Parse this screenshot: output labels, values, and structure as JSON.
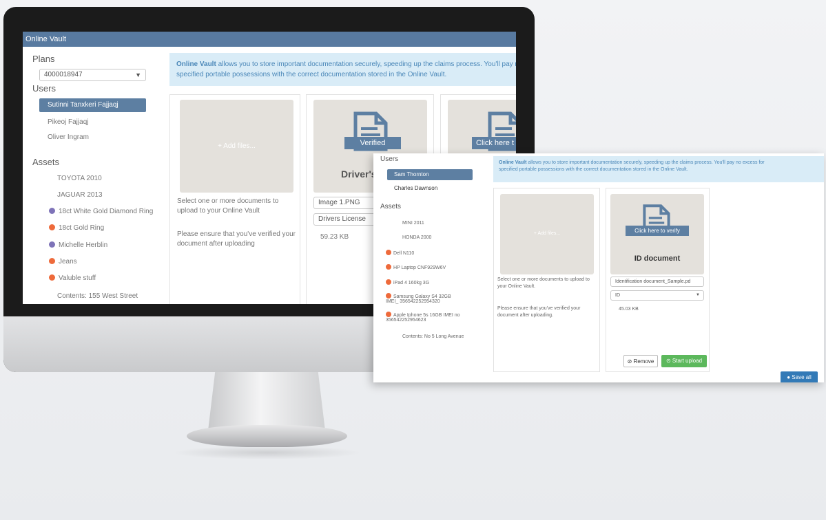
{
  "back_app": {
    "title": "Online Vault",
    "plans_label": "Plans",
    "plan_selected": "4000018947",
    "users_label": "Users",
    "users": [
      "Sutinni Tanxkeri Fajjaqj",
      "Pikeoj Fajjaqj",
      "Oliver Ingram"
    ],
    "assets_label": "Assets",
    "assets": [
      {
        "label": "TOYOTA 2010",
        "dot": ""
      },
      {
        "label": "JAGUAR 2013",
        "dot": ""
      },
      {
        "label": "18ct White Gold Diamond Ring",
        "dot": "purple"
      },
      {
        "label": "18ct Gold Ring",
        "dot": "orange"
      },
      {
        "label": "Michelle Herblin",
        "dot": "purple"
      },
      {
        "label": "Jeans",
        "dot": "orange"
      },
      {
        "label": "Valuble stuff",
        "dot": "orange"
      },
      {
        "label": "Contents: 155 West Street",
        "dot": ""
      }
    ],
    "info_line1_bold": "Online Vault",
    "info_line1": " allows you to store important documentation securely, speeding up the claims process. You'll pay no",
    "info_line2": "specified portable possessions with the correct documentation stored in the Online Vault.",
    "add_files": "Add files...",
    "upload_help": "Select one or more documents to upload to your Online Vault",
    "verify_help": "Please ensure that you've verified your document after uploading",
    "doc1_ribbon": "Verified",
    "doc1_title": "Driver's",
    "doc1_filename": "Image 1.PNG",
    "doc1_type": "Drivers License",
    "doc1_size": "59.23 KB",
    "doc2_ribbon": "Click here t"
  },
  "front_app": {
    "users_label": "Users",
    "users": [
      "Sam Thornton",
      "Charles Dawnson"
    ],
    "assets_label": "Assets",
    "assets": [
      {
        "label": "MINI 2011",
        "dot": ""
      },
      {
        "label": "HONDA 2000",
        "dot": ""
      },
      {
        "label": "Dell N110",
        "dot": "orange"
      },
      {
        "label": "HP Laptop CNF929W6V",
        "dot": "orange"
      },
      {
        "label": "iPad 4 160kg 3G",
        "dot": "orange"
      },
      {
        "label": "Samsung Galaxy S4 32GB",
        "label2": "IMEI_ 356542252954320",
        "dot": "orange"
      },
      {
        "label": "Apple Iphone 5s 16GB IMEI no",
        "label2": "356542252954623",
        "dot": "orange"
      },
      {
        "label": "Contents: No 5 Long Avenue",
        "dot": ""
      }
    ],
    "info_line1_bold": "Online Vault",
    "info_line1": " allows you to store important documentation securely, speeding up the claims process. You'll pay no excess for",
    "info_line2": "specified portable possessions with the correct documentation stored in the Online Vault.",
    "add_files": "Add files...",
    "upload_help": "Select one or more documents to upload to your Online Vault.",
    "verify_help": "Please ensure that you've verified your document after uploading.",
    "doc_ribbon": "Click here to verify",
    "doc_title": "ID document",
    "doc_filename": "Identification document_Sample.pd",
    "doc_type": "ID",
    "doc_size": "45.03 KB",
    "remove_label": "Remove",
    "start_upload_label": "Start upload",
    "save_all_label": "Save all"
  },
  "colors": {
    "accent": "#5d7fa2",
    "info_bg": "#d9ecf7",
    "orange_dot": "#ee6a3b",
    "purple_dot": "#7e73b8",
    "upload_green": "#5cb85c",
    "save_blue": "#337ab7"
  }
}
